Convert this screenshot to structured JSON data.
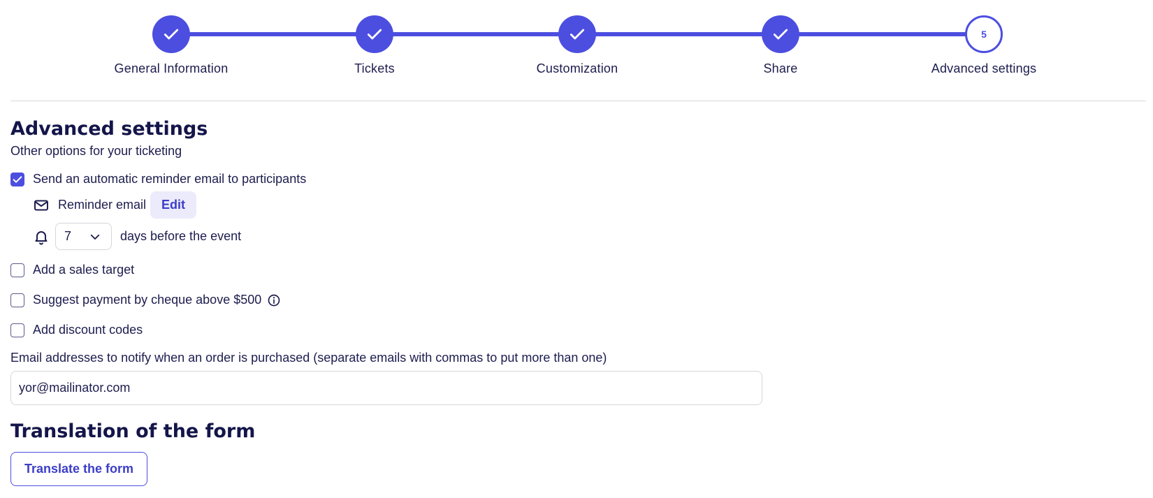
{
  "stepper": {
    "steps": [
      {
        "label": "General Information",
        "state": "done",
        "icon": "check-icon"
      },
      {
        "label": "Tickets",
        "state": "done",
        "icon": "check-icon"
      },
      {
        "label": "Customization",
        "state": "done",
        "icon": "check-icon"
      },
      {
        "label": "Share",
        "state": "done",
        "icon": "check-icon"
      },
      {
        "label": "Advanced settings",
        "state": "current",
        "number": "5"
      }
    ]
  },
  "advanced": {
    "title": "Advanced settings",
    "subtitle": "Other options for your ticketing",
    "reminder_checkbox": {
      "label": "Send an automatic reminder email to participants",
      "checked": true
    },
    "reminder_email": {
      "label": "Reminder email",
      "edit_label": "Edit",
      "icon": "mail-icon"
    },
    "reminder_days": {
      "value": "7",
      "suffix": "days before the event",
      "icon": "bell-icon"
    },
    "sales_target": {
      "label": "Add a sales target",
      "checked": false
    },
    "cheque": {
      "label": "Suggest payment by cheque above $500",
      "checked": false,
      "icon": "info-icon"
    },
    "discount": {
      "label": "Add discount codes",
      "checked": false
    },
    "notify": {
      "label": "Email addresses to notify when an order is purchased (separate emails with commas to put more than one)",
      "value": "yor@mailinator.com"
    }
  },
  "translation": {
    "title": "Translation of the form",
    "button_label": "Translate the form"
  },
  "colors": {
    "accent": "#4c4ee0",
    "text": "#1c1d4e"
  }
}
